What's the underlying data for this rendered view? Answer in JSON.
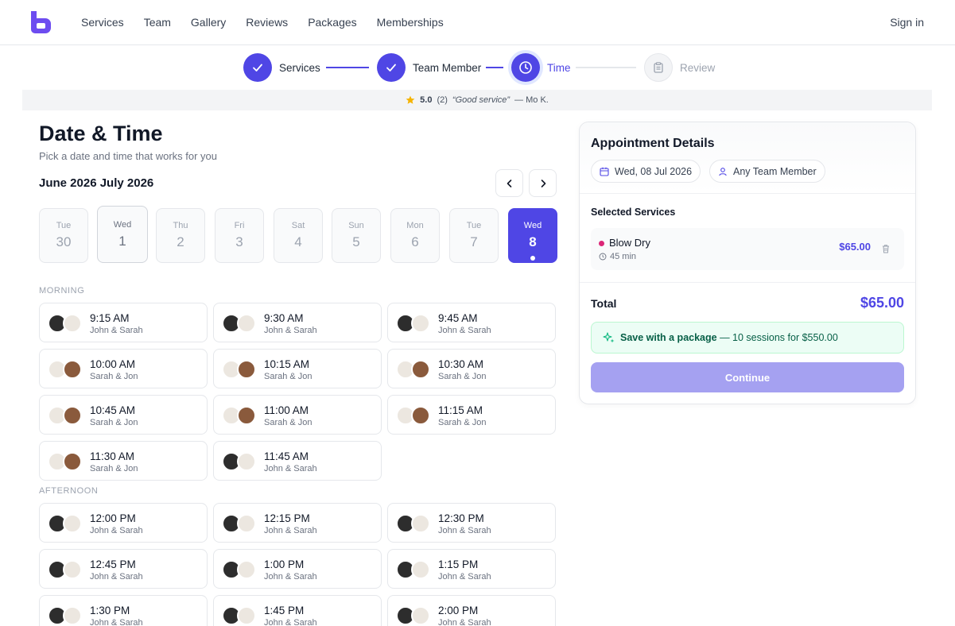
{
  "header": {
    "nav": [
      "Services",
      "Team",
      "Gallery",
      "Reviews",
      "Packages",
      "Memberships"
    ],
    "signin": "Sign in"
  },
  "stepper": {
    "steps": [
      {
        "label": "Services",
        "state": "done"
      },
      {
        "label": "Team Member",
        "state": "done"
      },
      {
        "label": "Time",
        "state": "active"
      },
      {
        "label": "Review",
        "state": "pending"
      }
    ]
  },
  "review": {
    "rating": "5.0",
    "count": "(2)",
    "quote": "“Good service”",
    "author": "— Mo K."
  },
  "booking": {
    "title": "Date & Time",
    "subtitle": "Pick a date and time that works for you",
    "months": "June 2026  July 2026",
    "days": [
      {
        "dow": "Tue",
        "num": "30",
        "state": "unavailable"
      },
      {
        "dow": "Wed",
        "num": "1",
        "state": "available"
      },
      {
        "dow": "Thu",
        "num": "2",
        "state": "unavailable"
      },
      {
        "dow": "Fri",
        "num": "3",
        "state": "unavailable"
      },
      {
        "dow": "Sat",
        "num": "4",
        "state": "unavailable"
      },
      {
        "dow": "Sun",
        "num": "5",
        "state": "unavailable"
      },
      {
        "dow": "Mon",
        "num": "6",
        "state": "unavailable"
      },
      {
        "dow": "Tue",
        "num": "7",
        "state": "unavailable"
      },
      {
        "dow": "Wed",
        "num": "8",
        "state": "selected"
      }
    ],
    "morning_label": "MORNING",
    "afternoon_label": "AFTERNOON",
    "morning": [
      {
        "time": "9:15 AM",
        "staff": "John & Sarah"
      },
      {
        "time": "9:30 AM",
        "staff": "John & Sarah"
      },
      {
        "time": "9:45 AM",
        "staff": "John & Sarah"
      },
      {
        "time": "10:00 AM",
        "staff": "Sarah & Jon"
      },
      {
        "time": "10:15 AM",
        "staff": "Sarah & Jon"
      },
      {
        "time": "10:30 AM",
        "staff": "Sarah & Jon"
      },
      {
        "time": "10:45 AM",
        "staff": "Sarah & Jon"
      },
      {
        "time": "11:00 AM",
        "staff": "Sarah & Jon"
      },
      {
        "time": "11:15 AM",
        "staff": "Sarah & Jon"
      },
      {
        "time": "11:30 AM",
        "staff": "Sarah & Jon"
      },
      {
        "time": "11:45 AM",
        "staff": "John & Sarah"
      }
    ],
    "afternoon": [
      {
        "time": "12:00 PM",
        "staff": "John & Sarah"
      },
      {
        "time": "12:15 PM",
        "staff": "John & Sarah"
      },
      {
        "time": "12:30 PM",
        "staff": "John & Sarah"
      },
      {
        "time": "12:45 PM",
        "staff": "John & Sarah"
      },
      {
        "time": "1:00 PM",
        "staff": "John & Sarah"
      },
      {
        "time": "1:15 PM",
        "staff": "John & Sarah"
      },
      {
        "time": "1:30 PM",
        "staff": "John & Sarah"
      },
      {
        "time": "1:45 PM",
        "staff": "John & Sarah"
      },
      {
        "time": "2:00 PM",
        "staff": "John & Sarah"
      }
    ]
  },
  "details": {
    "title": "Appointment Details",
    "date_chip": "Wed, 08 Jul 2026",
    "member_chip": "Any Team Member",
    "selected_label": "Selected Services",
    "service": {
      "name": "Blow Dry",
      "duration": "45 min",
      "price": "$65.00"
    },
    "total_label": "Total",
    "total_value": "$65.00",
    "promo_bold": "Save with a package",
    "promo_rest": " — 10 sessions for $550.00",
    "continue": "Continue"
  },
  "colors": {
    "accent": "#4f46e5",
    "accent_disabled": "#a5a1f1",
    "promo_bg": "#ecfdf5",
    "service_dot": "#db2777"
  }
}
